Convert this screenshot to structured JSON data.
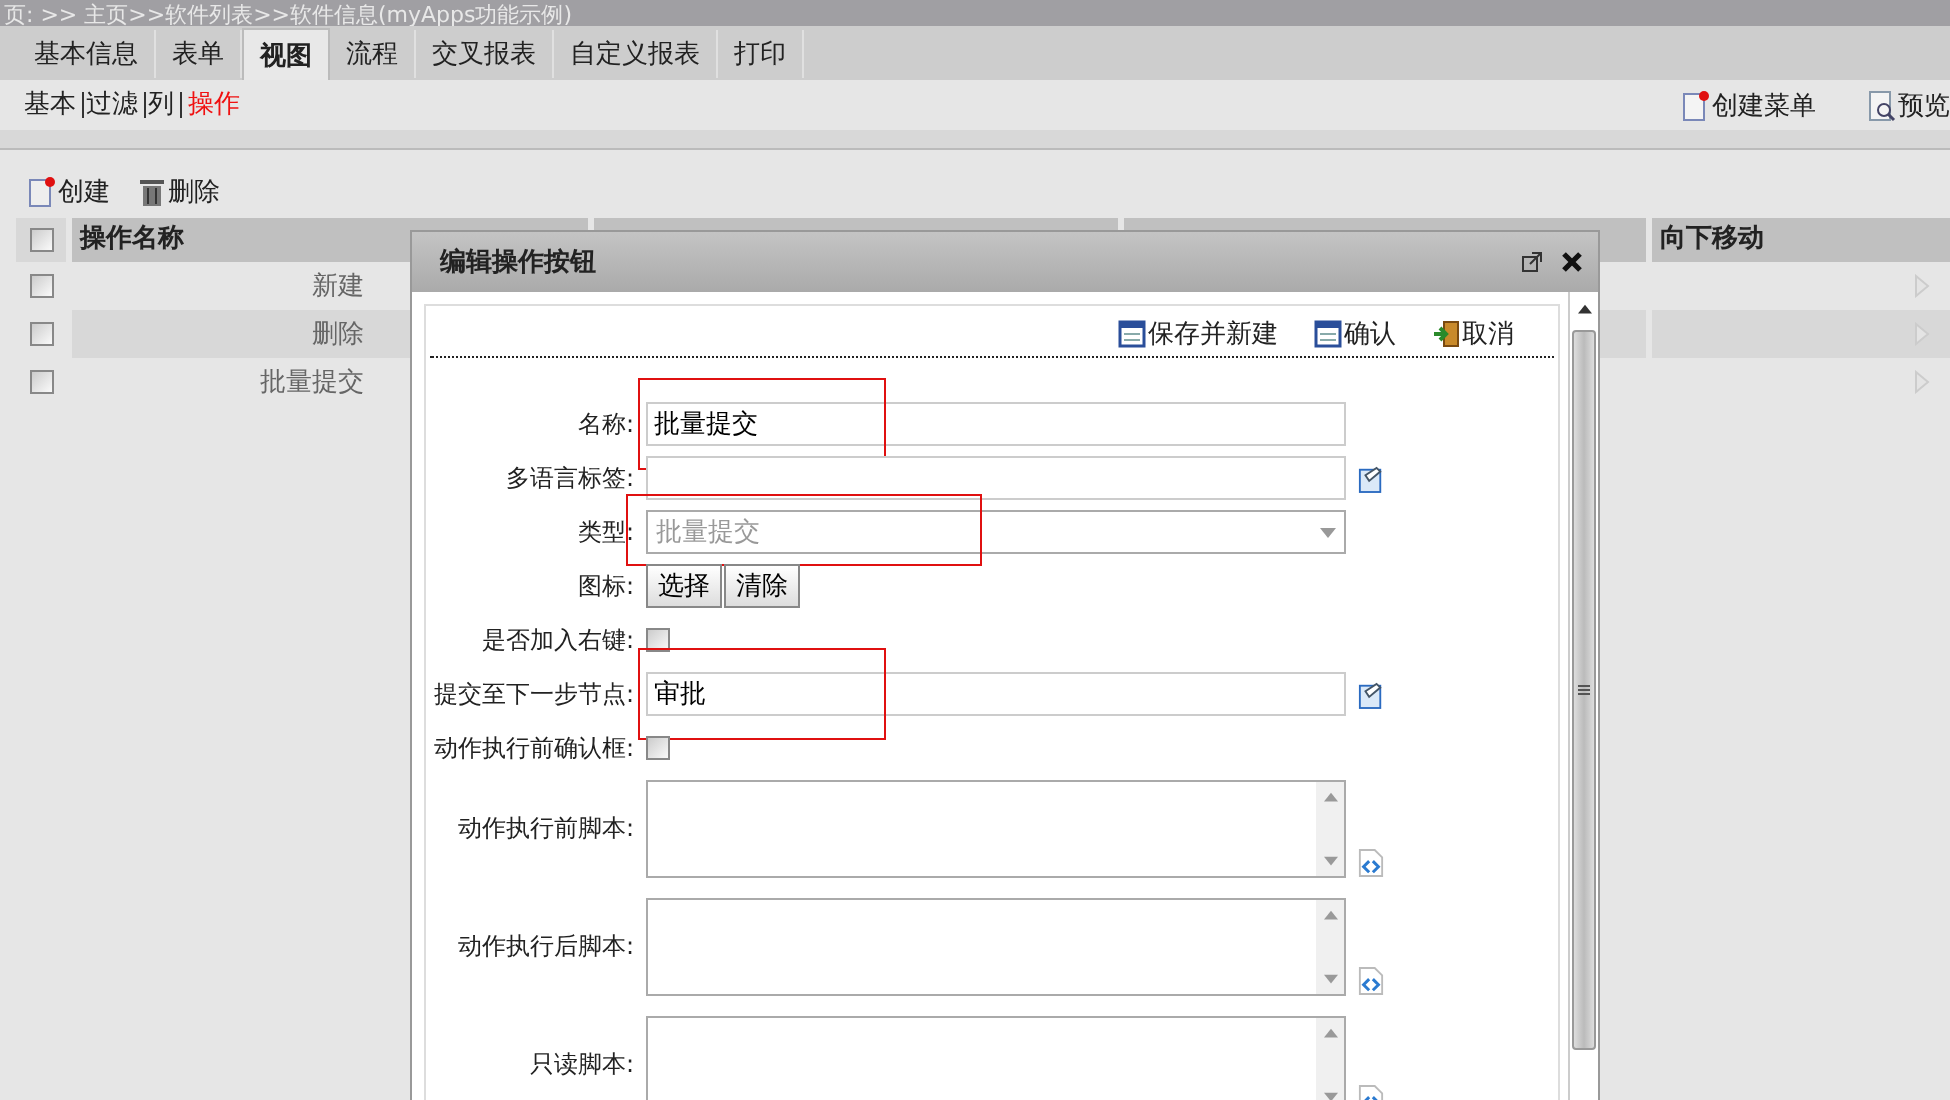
{
  "breadcrumb": "页: >> 主页>>软件列表>>软件信息(myApps功能示例)",
  "tabs": [
    {
      "label": "基本信息",
      "selected": false
    },
    {
      "label": "表单",
      "selected": false
    },
    {
      "label": "视图",
      "selected": true
    },
    {
      "label": "流程",
      "selected": false
    },
    {
      "label": "交叉报表",
      "selected": false
    },
    {
      "label": "自定义报表",
      "selected": false
    },
    {
      "label": "打印",
      "selected": false
    }
  ],
  "subtabs": [
    {
      "label": "基本",
      "selected": false
    },
    {
      "label": "过滤",
      "selected": false
    },
    {
      "label": "列",
      "selected": false
    },
    {
      "label": "操作",
      "selected": true
    }
  ],
  "right_actions": [
    {
      "label": "创建菜单",
      "kind": "new"
    },
    {
      "label": "预览",
      "kind": "preview"
    }
  ],
  "toolbar": [
    {
      "label": "创建",
      "kind": "new"
    },
    {
      "label": "删除",
      "kind": "delete"
    }
  ],
  "table": {
    "all_checked": false,
    "columns": [
      "操作名称",
      "向下移动"
    ],
    "rows": [
      {
        "name": "新建",
        "checked": false
      },
      {
        "name": "删除",
        "checked": false
      },
      {
        "name": "批量提交",
        "checked": false
      }
    ]
  },
  "dialog": {
    "title": "编辑操作按钮",
    "actions": [
      {
        "label": "保存并新建",
        "kind": "save"
      },
      {
        "label": "确认",
        "kind": "save"
      },
      {
        "label": "取消",
        "kind": "cancel"
      }
    ],
    "fields": [
      {
        "label": "名称:",
        "kind": "text",
        "value": "批量提交",
        "picker": false,
        "highlighted": true
      },
      {
        "label": "多语言标签:",
        "kind": "text",
        "picker": true,
        "highlighted": false
      },
      {
        "label": "类型:",
        "kind": "select",
        "value": "批量提交",
        "highlighted": true
      },
      {
        "label": "图标:",
        "kind": "buttons",
        "buttons": [
          "选择",
          "清除"
        ]
      },
      {
        "label": "是否加入右键:",
        "kind": "checkbox",
        "checked": false
      },
      {
        "label": "提交至下一步节点:",
        "kind": "text",
        "value": "审批",
        "picker": true,
        "highlighted": true
      },
      {
        "label": "动作执行前确认框:",
        "kind": "checkbox",
        "checked": false
      },
      {
        "label": "动作执行前脚本:",
        "kind": "textarea"
      },
      {
        "label": "动作执行后脚本:",
        "kind": "textarea"
      },
      {
        "label": "只读脚本:",
        "kind": "textarea"
      }
    ]
  }
}
